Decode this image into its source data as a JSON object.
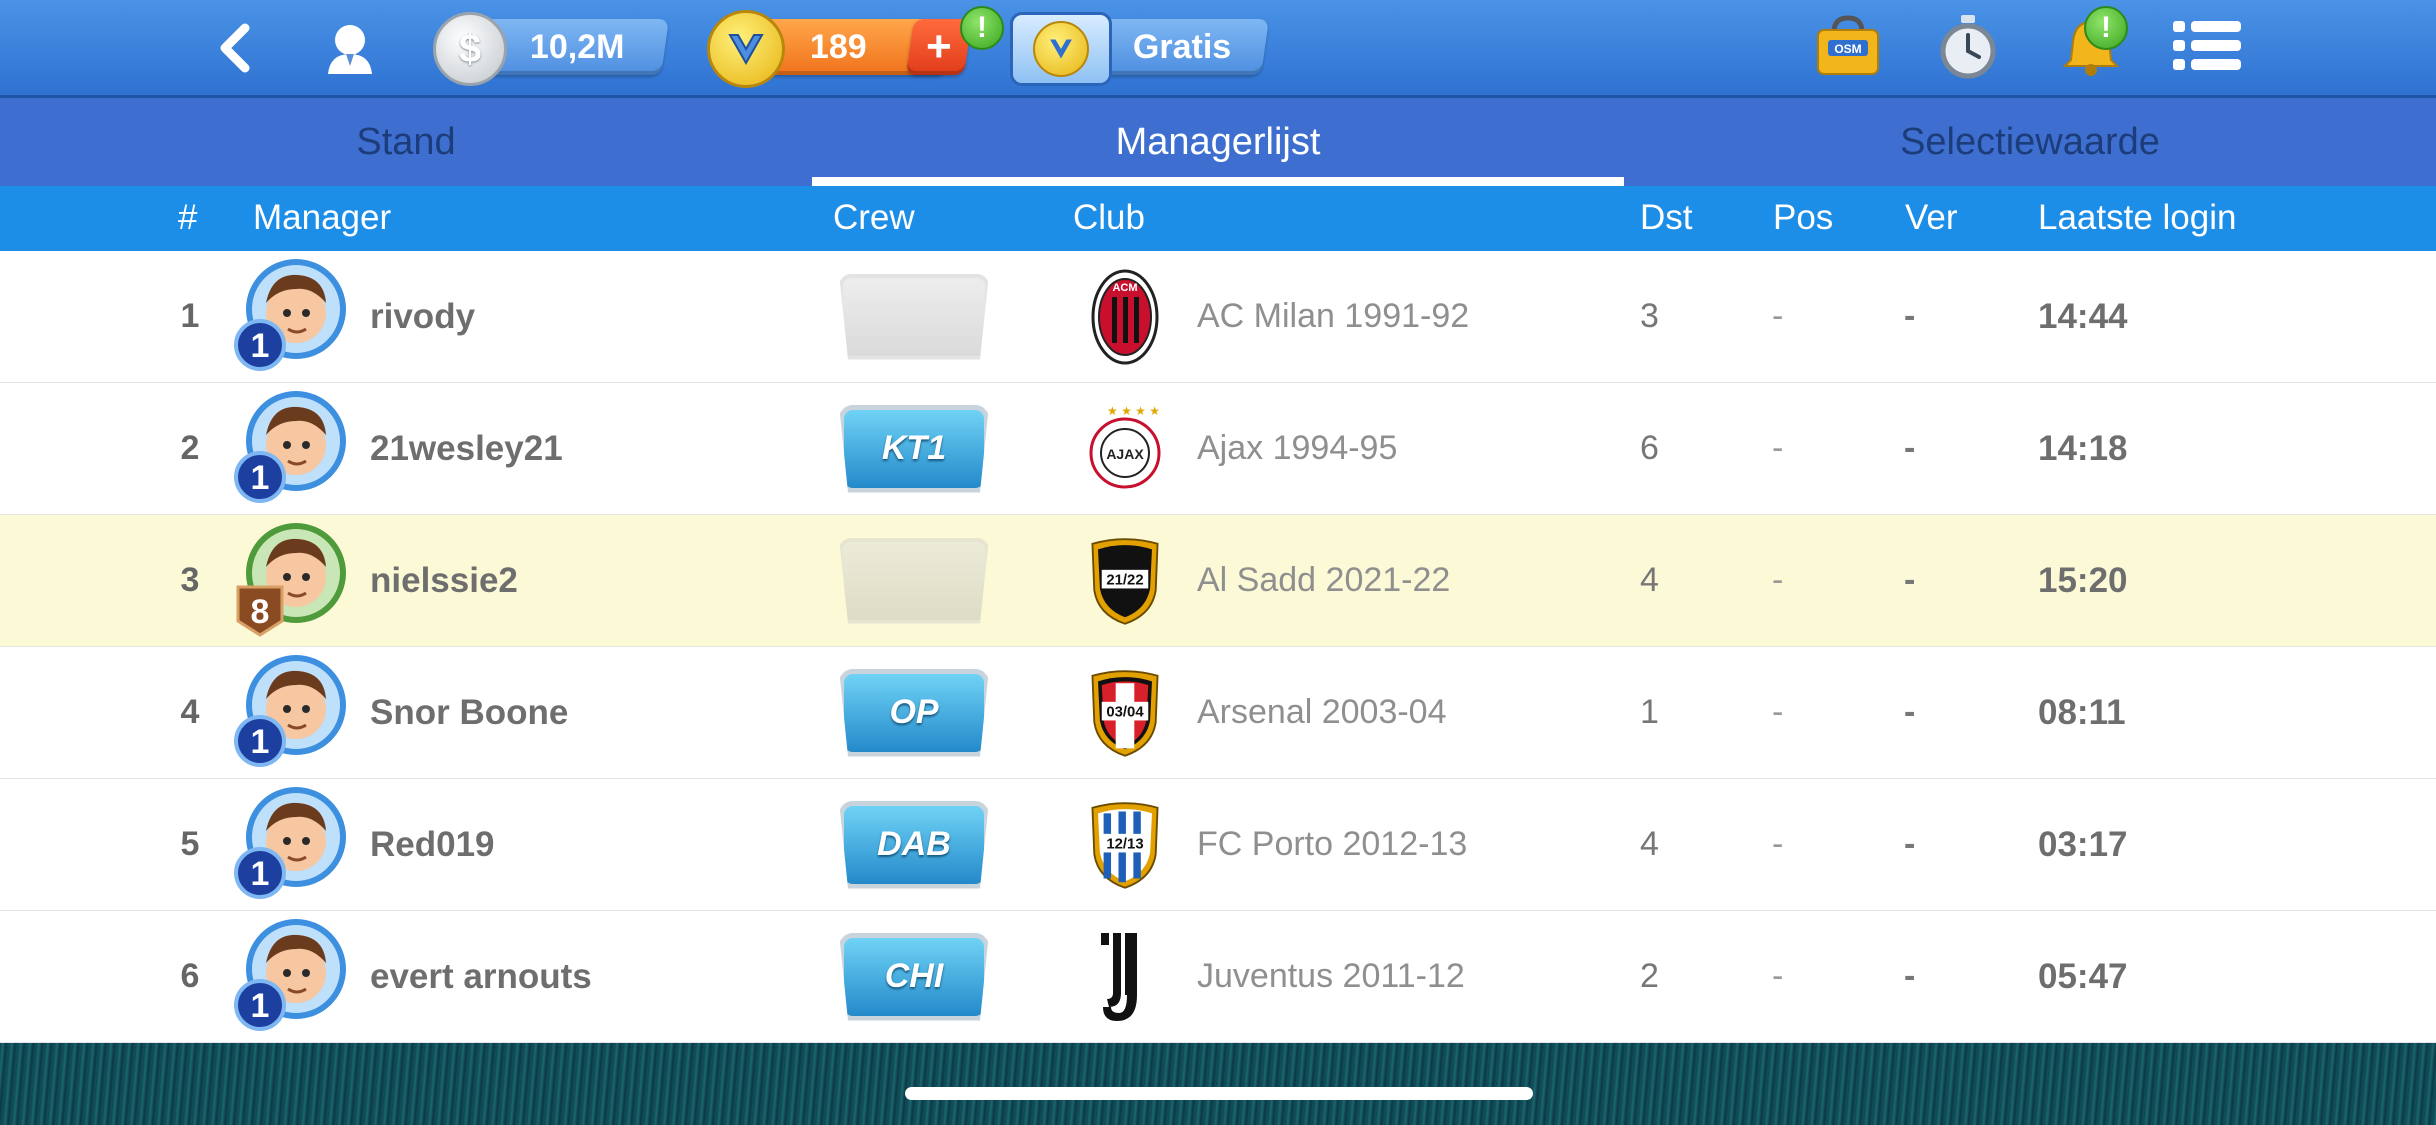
{
  "topbar": {
    "icons": [
      "back-icon",
      "profile-icon",
      "shop-bag-icon",
      "stopwatch-icon",
      "bell-icon",
      "menu-list-icon"
    ],
    "shop_bag_label": "OSM",
    "money": "10,2M",
    "coins": "189",
    "plus": "+",
    "gratis": "Gratis",
    "alert_mark": "!"
  },
  "tabs": [
    {
      "label": "Stand",
      "active": false
    },
    {
      "label": "Managerlijst",
      "active": true
    },
    {
      "label": "Selectiewaarde",
      "active": false
    }
  ],
  "columns": {
    "rank": "#",
    "manager": "Manager",
    "crew": "Crew",
    "club": "Club",
    "dst": "Dst",
    "pos": "Pos",
    "ver": "Ver",
    "login": "Laatste login"
  },
  "rows": [
    {
      "rank": "1",
      "level": "1",
      "name": "rivody",
      "crew": "",
      "logo": "ACM",
      "club": "AC Milan 1991-92",
      "dst": "3",
      "pos": "-",
      "ver": "-",
      "login": "14:44"
    },
    {
      "rank": "2",
      "level": "1",
      "name": "21wesley21",
      "crew": "KT1",
      "logo": "AJAX",
      "club": "Ajax 1994-95",
      "dst": "6",
      "pos": "-",
      "ver": "-",
      "login": "14:18"
    },
    {
      "rank": "3",
      "level": "8",
      "name": "nielssie2",
      "crew": "",
      "logo": "21/22",
      "club": "Al Sadd 2021-22",
      "dst": "4",
      "pos": "-",
      "ver": "-",
      "login": "15:20"
    },
    {
      "rank": "4",
      "level": "1",
      "name": "Snor Boone",
      "crew": "OP",
      "logo": "03/04",
      "club": "Arsenal 2003-04",
      "dst": "1",
      "pos": "-",
      "ver": "-",
      "login": "08:11"
    },
    {
      "rank": "5",
      "level": "1",
      "name": "Red019",
      "crew": "DAB",
      "logo": "12/13",
      "club": "FC Porto 2012-13",
      "dst": "4",
      "pos": "-",
      "ver": "-",
      "login": "03:17"
    },
    {
      "rank": "6",
      "level": "1",
      "name": "evert arnouts",
      "crew": "CHI",
      "logo": "J",
      "club": "Juventus 2011-12",
      "dst": "2",
      "pos": "-",
      "ver": "-",
      "login": "05:47"
    }
  ]
}
